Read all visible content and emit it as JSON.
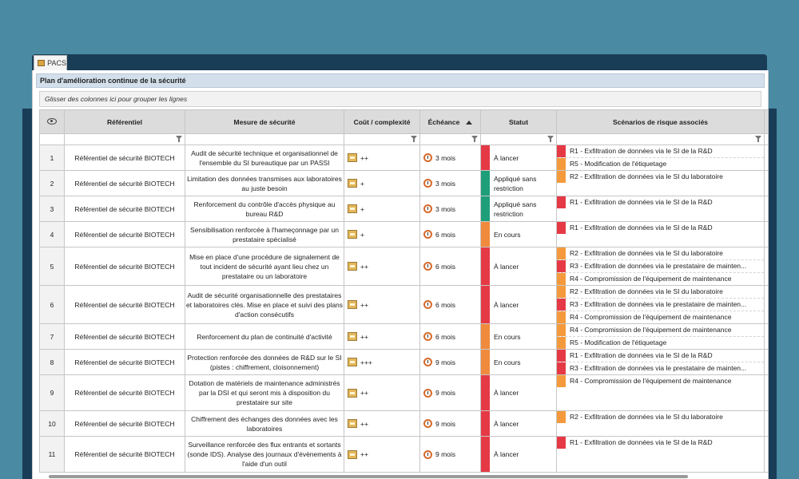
{
  "tab": {
    "label": "PACS"
  },
  "panel_title": "Plan d'amélioration continue de la sécurité",
  "group_hint": "Glisser des colonnes ici pour grouper les lignes",
  "columns": {
    "ref": "Référentiel",
    "mesure": "Mesure de sécurité",
    "cout": "Coût / complexité",
    "echeance": "Échéance",
    "statut": "Statut",
    "scenarios": "Scénarios de risque associés"
  },
  "status_colors": {
    "À lancer": "#e63946",
    "Appliqué sans restriction": "#1f9e7a",
    "En cours": "#f08a3c"
  },
  "risk_colors": {
    "R1": "#e63946",
    "R2": "#f59a3c",
    "R3": "#e63946",
    "R4": "#f59a3c",
    "R5": "#f59a3c"
  },
  "rows": [
    {
      "num": "1",
      "ref": "Référentiel de sécurité BIOTECH",
      "mesure": "Audit de sécurité technique et organisationnel de l'ensemble du SI bureautique par un PASSI",
      "cout": "++",
      "echeance": "3 mois",
      "statut": "À lancer",
      "statut_color": "#e63946",
      "h": 32,
      "scen": [
        {
          "t": "R1 - Exfiltration de données via le SI de la R&D",
          "c": "#e63946"
        },
        {
          "t": "R5 - Modification de l'étiquetage",
          "c": "#f59a3c"
        }
      ]
    },
    {
      "num": "2",
      "ref": "Référentiel de sécurité BIOTECH",
      "mesure": "Limitation des données transmises aux laboratoires au juste besoin",
      "cout": "+",
      "echeance": "3 mois",
      "statut": "Appliqué sans restriction",
      "statut_color": "#1f9e7a",
      "h": 32,
      "scen": [
        {
          "t": "R2 - Exfiltration de données via le SI du laboratoire",
          "c": "#f59a3c"
        }
      ]
    },
    {
      "num": "3",
      "ref": "Référentiel de sécurité BIOTECH",
      "mesure": "Renforcement du contrôle d'accès physique au bureau R&D",
      "cout": "+",
      "echeance": "3 mois",
      "statut": "Appliqué sans restriction",
      "statut_color": "#1f9e7a",
      "h": 32,
      "scen": [
        {
          "t": "R1 - Exfiltration de données via le SI de la R&D",
          "c": "#e63946"
        }
      ]
    },
    {
      "num": "4",
      "ref": "Référentiel de sécurité BIOTECH",
      "mesure": "Sensibilisation renforcée à l'hameçonnage par un prestataire spécialisé",
      "cout": "+",
      "echeance": "6 mois",
      "statut": "En cours",
      "statut_color": "#f08a3c",
      "h": 32,
      "scen": [
        {
          "t": "R1 - Exfiltration de données via le SI de la R&D",
          "c": "#e63946"
        }
      ]
    },
    {
      "num": "5",
      "ref": "Référentiel de sécurité BIOTECH",
      "mesure": "Mise en place d'une procédure de signalement de tout incident de sécurité ayant lieu chez un prestataire ou un laboratoire",
      "cout": "++",
      "echeance": "6 mois",
      "statut": "À lancer",
      "statut_color": "#e63946",
      "h": 48,
      "scen": [
        {
          "t": "R2 - Exfiltration de données via le SI du laboratoire",
          "c": "#f59a3c"
        },
        {
          "t": "R3 - Exfiltration de données via le prestataire de mainten...",
          "c": "#e63946"
        },
        {
          "t": "R4 - Compromission de l'équipement de maintenance",
          "c": "#f59a3c"
        }
      ]
    },
    {
      "num": "6",
      "ref": "Référentiel de sécurité BIOTECH",
      "mesure": "Audit de sécurité organisationnelle des prestataires et laboratoires clés. Mise en place et suivi des plans d'action consécutifs",
      "cout": "++",
      "echeance": "6 mois",
      "statut": "À lancer",
      "statut_color": "#e63946",
      "h": 48,
      "scen": [
        {
          "t": "R2 - Exfiltration de données via le SI du laboratoire",
          "c": "#f59a3c"
        },
        {
          "t": "R3 - Exfiltration de données via le prestataire de mainten...",
          "c": "#e63946"
        },
        {
          "t": "R4 - Compromission de l'équipement de maintenance",
          "c": "#f59a3c"
        }
      ]
    },
    {
      "num": "7",
      "ref": "Référentiel de sécurité BIOTECH",
      "mesure": "Renforcement du plan de continuité d'activité",
      "cout": "++",
      "echeance": "6 mois",
      "statut": "En cours",
      "statut_color": "#f08a3c",
      "h": 32,
      "scen": [
        {
          "t": "R4 - Compromission de l'équipement de maintenance",
          "c": "#f59a3c"
        },
        {
          "t": "R5 - Modification de l'étiquetage",
          "c": "#f59a3c"
        }
      ]
    },
    {
      "num": "8",
      "ref": "Référentiel de sécurité BIOTECH",
      "mesure": "Protection renforcée des données de R&D sur le SI (pistes : chiffrement, cloisonnement)",
      "cout": "+++",
      "echeance": "9 mois",
      "statut": "En cours",
      "statut_color": "#f08a3c",
      "h": 32,
      "scen": [
        {
          "t": "R1 - Exfiltration de données via le SI de la R&D",
          "c": "#e63946"
        },
        {
          "t": "R3 - Exfiltration de données via le prestataire de mainten...",
          "c": "#e63946"
        }
      ]
    },
    {
      "num": "9",
      "ref": "Référentiel de sécurité BIOTECH",
      "mesure": "Dotation de matériels de maintenance administrés par la DSI et qui seront mis à disposition du prestataire sur site",
      "cout": "++",
      "echeance": "9 mois",
      "statut": "À lancer",
      "statut_color": "#e63946",
      "h": 45,
      "scen": [
        {
          "t": "R4 - Compromission de l'équipement de maintenance",
          "c": "#f59a3c"
        }
      ]
    },
    {
      "num": "10",
      "ref": "Référentiel de sécurité BIOTECH",
      "mesure": "Chiffrement des échanges des données avec les laboratoires",
      "cout": "++",
      "echeance": "9 mois",
      "statut": "À lancer",
      "statut_color": "#e63946",
      "h": 32,
      "scen": [
        {
          "t": "R2 - Exfiltration de données via le SI du laboratoire",
          "c": "#f59a3c"
        }
      ]
    },
    {
      "num": "11",
      "ref": "Référentiel de sécurité BIOTECH",
      "mesure": "Surveillance renforcée des flux entrants et sortants (sonde IDS). Analyse des journaux d'évènements à l'aide d'un outil",
      "cout": "++",
      "echeance": "9 mois",
      "statut": "À lancer",
      "statut_color": "#e63946",
      "h": 45,
      "scen": [
        {
          "t": "R1 - Exfiltration de données via le SI de la R&D",
          "c": "#e63946"
        }
      ]
    }
  ]
}
